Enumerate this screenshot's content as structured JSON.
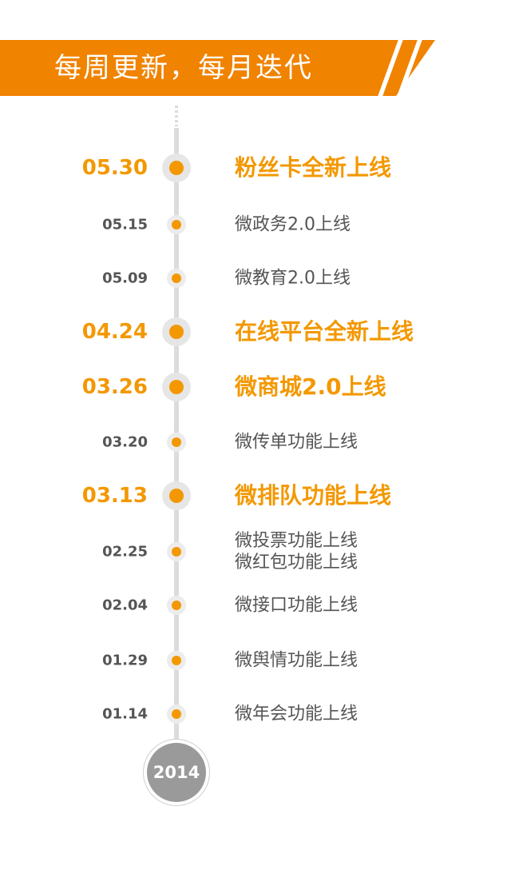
{
  "header": {
    "title": "每周更新，每月迭代"
  },
  "timeline": {
    "entries": [
      {
        "date": "05.30",
        "lines": [
          "粉丝卡全新上线"
        ],
        "major": true
      },
      {
        "date": "05.15",
        "lines": [
          "微政务2.0上线"
        ],
        "major": false
      },
      {
        "date": "05.09",
        "lines": [
          "微教育2.0上线"
        ],
        "major": false
      },
      {
        "date": "04.24",
        "lines": [
          "在线平台全新上线"
        ],
        "major": true
      },
      {
        "date": "03.26",
        "lines": [
          "微商城2.0上线"
        ],
        "major": true
      },
      {
        "date": "03.20",
        "lines": [
          "微传单功能上线"
        ],
        "major": false
      },
      {
        "date": "03.13",
        "lines": [
          "微排队功能上线"
        ],
        "major": true
      },
      {
        "date": "02.25",
        "lines": [
          "微投票功能上线",
          "微红包功能上线"
        ],
        "major": false
      },
      {
        "date": "02.04",
        "lines": [
          "微接口功能上线"
        ],
        "major": false
      },
      {
        "date": "01.29",
        "lines": [
          "微舆情功能上线"
        ],
        "major": false
      },
      {
        "date": "01.14",
        "lines": [
          "微年会功能上线"
        ],
        "major": false
      }
    ],
    "year": "2014"
  },
  "colors": {
    "accent": "#F39800",
    "banner": "#F08300",
    "text": "#555555",
    "line": "#dcdcdc",
    "year_badge": "#9a9a9a"
  }
}
